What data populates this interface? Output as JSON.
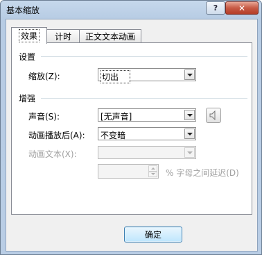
{
  "window": {
    "title": "基本缩放",
    "help_label": "?",
    "close_label": "✕"
  },
  "tabs": [
    {
      "label": "效果",
      "active": true
    },
    {
      "label": "计时",
      "active": false
    },
    {
      "label": "正文文本动画",
      "active": false
    }
  ],
  "settings": {
    "group_title": "设置",
    "zoom_label": "缩放(Z):",
    "zoom_value": "切出"
  },
  "enhance": {
    "group_title": "增强",
    "sound_label": "声音(S):",
    "sound_value": "[无声音]",
    "after_label": "动画播放后(A):",
    "after_value": "不变暗",
    "animate_text_label": "动画文本(X):",
    "animate_text_value": "",
    "delay_value": "",
    "delay_label": "% 字母之间延迟(D)"
  },
  "buttons": {
    "ok_label": "确定"
  },
  "icons": {
    "speaker": "speaker-icon",
    "dropdown": "chevron-down-icon"
  }
}
